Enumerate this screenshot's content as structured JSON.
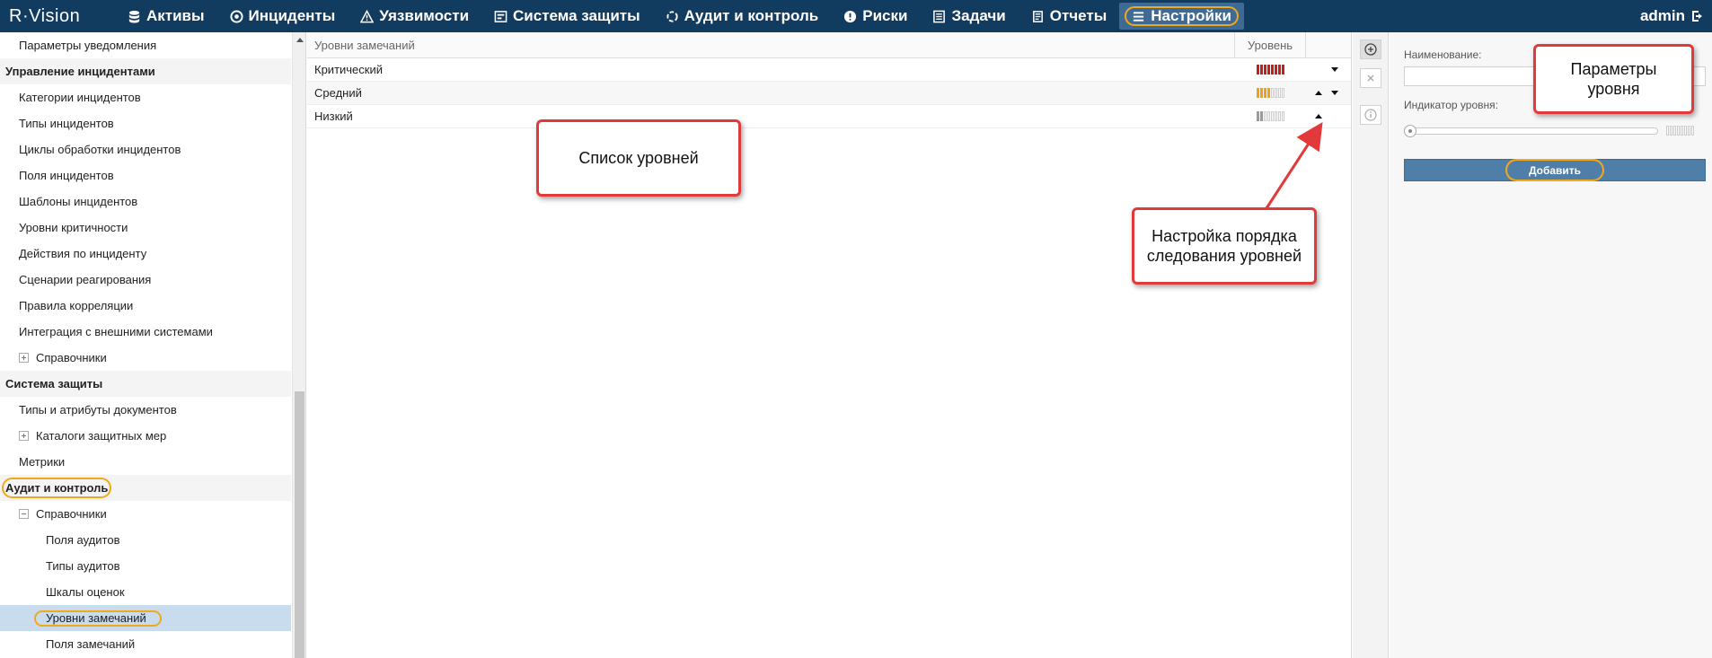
{
  "app": {
    "logo": "R·Vision",
    "user": "admin"
  },
  "nav": [
    {
      "label": "Активы",
      "icon": "database-icon"
    },
    {
      "label": "Инциденты",
      "icon": "target-icon"
    },
    {
      "label": "Уязвимости",
      "icon": "warning-icon"
    },
    {
      "label": "Система защиты",
      "icon": "shield-icon"
    },
    {
      "label": "Аудит и контроль",
      "icon": "cycle-icon"
    },
    {
      "label": "Риски",
      "icon": "alert-icon"
    },
    {
      "label": "Задачи",
      "icon": "tasks-icon"
    },
    {
      "label": "Отчеты",
      "icon": "reports-icon"
    },
    {
      "label": "Настройки",
      "icon": "menu-icon",
      "active": true
    }
  ],
  "sidebar": {
    "items": [
      {
        "label": "Параметры уведомления",
        "level": "l1"
      },
      {
        "label": "Управление инцидентами",
        "level": "group"
      },
      {
        "label": "Категории инцидентов",
        "level": "l1"
      },
      {
        "label": "Типы инцидентов",
        "level": "l1"
      },
      {
        "label": "Циклы обработки инцидентов",
        "level": "l1"
      },
      {
        "label": "Поля инцидентов",
        "level": "l1"
      },
      {
        "label": "Шаблоны инцидентов",
        "level": "l1"
      },
      {
        "label": "Уровни критичности",
        "level": "l1"
      },
      {
        "label": "Действия по инциденту",
        "level": "l1"
      },
      {
        "label": "Сценарии реагирования",
        "level": "l1"
      },
      {
        "label": "Правила корреляции",
        "level": "l1"
      },
      {
        "label": "Интеграция с внешними системами",
        "level": "l1"
      },
      {
        "label": "Справочники",
        "level": "l1t",
        "toggle": "plus"
      },
      {
        "label": "Система защиты",
        "level": "group"
      },
      {
        "label": "Типы и атрибуты документов",
        "level": "l1"
      },
      {
        "label": "Каталоги защитных мер",
        "level": "l1t",
        "toggle": "plus"
      },
      {
        "label": "Метрики",
        "level": "l1"
      },
      {
        "label": "Аудит и контроль",
        "level": "group",
        "ring": true
      },
      {
        "label": "Справочники",
        "level": "l1t",
        "toggle": "minus"
      },
      {
        "label": "Поля аудитов",
        "level": "l2"
      },
      {
        "label": "Типы аудитов",
        "level": "l2"
      },
      {
        "label": "Шкалы оценок",
        "level": "l2"
      },
      {
        "label": "Уровни замечаний",
        "level": "l2",
        "selected": true,
        "ring": true
      },
      {
        "label": "Поля замечаний",
        "level": "l2"
      }
    ]
  },
  "grid": {
    "col_name": "Уровни замечаний",
    "col_level": "Уровень",
    "rows": [
      {
        "name": "Критический",
        "filled": 8,
        "total": 8,
        "color": "#c0201e",
        "up": false,
        "down": true
      },
      {
        "name": "Средний",
        "filled": 4,
        "total": 8,
        "color": "#e8a21e",
        "up": true,
        "down": true
      },
      {
        "name": "Низкий",
        "filled": 2,
        "total": 8,
        "color": "#9a9a9a",
        "up": true,
        "down": false
      }
    ]
  },
  "tools": [
    {
      "name": "add-tool-button",
      "icon": "plus-circle-icon",
      "enabled": true
    },
    {
      "name": "delete-tool-button",
      "icon": "close-icon",
      "enabled": false
    },
    {
      "name": "info-tool-button",
      "icon": "info-icon",
      "enabled": false
    }
  ],
  "props": {
    "name_label": "Наименование:",
    "name_value": "",
    "indicator_label": "Индикатор уровня:",
    "indicator_level": 0,
    "add_label": "Добавить"
  },
  "callouts": {
    "list": "Список уровней",
    "order": "Настройка порядка\nследования уровней",
    "params": "Параметры\nуровня"
  },
  "colors": {
    "topbar": "#123b60",
    "accent_ring": "#f0a81c",
    "callout_border": "#e23a3a",
    "selected_row": "#c8dcee"
  }
}
